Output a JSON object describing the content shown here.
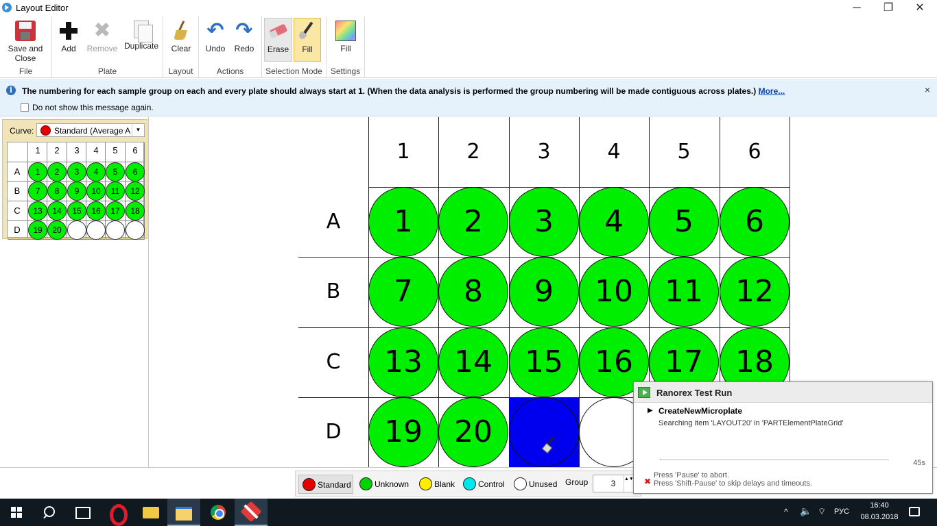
{
  "window": {
    "title": "Layout Editor",
    "minimize": "─",
    "restore": "❐",
    "close": "✕"
  },
  "ribbon": {
    "groups": {
      "file": "File",
      "plate": "Plate",
      "layout": "Layout",
      "actions": "Actions",
      "selection_mode": "Selection Mode",
      "settings": "Settings"
    },
    "buttons": {
      "save_close_line1": "Save and",
      "save_close_line2": "Close",
      "add": "Add",
      "remove": "Remove",
      "duplicate": "Duplicate",
      "clear": "Clear",
      "undo": "Undo",
      "redo": "Redo",
      "erase": "Erase",
      "fill_mode": "Fill",
      "fill_settings": "Fill"
    },
    "icons": {
      "remove": "✖",
      "undo": "↶",
      "redo": "↷"
    }
  },
  "infobar": {
    "icon": "i",
    "message": "The numbering for each sample group on each and every plate should always start at 1. (When the data analysis is performed the group numbering will be made contiguous across plates.) ",
    "more_link": "More...",
    "close": "×",
    "dont_show": "Do not show this message again."
  },
  "curve": {
    "label": "Curve:",
    "selected": "Standard (Average A",
    "arrow": "▼",
    "dot_color": "#e50000"
  },
  "plate": {
    "columns": [
      "1",
      "2",
      "3",
      "4",
      "5",
      "6"
    ],
    "rows": [
      "A",
      "B",
      "C",
      "D"
    ],
    "wells": [
      [
        "1",
        "2",
        "3",
        "4",
        "5",
        "6"
      ],
      [
        "7",
        "8",
        "9",
        "10",
        "11",
        "12"
      ],
      [
        "13",
        "14",
        "15",
        "16",
        "17",
        "18"
      ],
      [
        "19",
        "20",
        "",
        "",
        "",
        ""
      ]
    ],
    "selected_well": "D3",
    "colors": {
      "unknown": "#00ee00",
      "selected": "#0000ee",
      "unused": "#ffffff"
    }
  },
  "legend": {
    "items": [
      {
        "label": "Standard",
        "color": "#e50000"
      },
      {
        "label": "Unknown",
        "color": "#00d400"
      },
      {
        "label": "Blank",
        "color": "#ffee00"
      },
      {
        "label": "Control",
        "color": "#00e5ee"
      },
      {
        "label": "Unused",
        "color": "#ffffff"
      }
    ],
    "group_label": "Group",
    "group_value": "3",
    "spin": "▲▼"
  },
  "ranorex": {
    "title": "Ranorex Test Run",
    "arrow": "▶",
    "test_name": "CreateNewMicroplate",
    "status": "Searching item 'LAYOUT20' in 'PARTElementPlateGrid'",
    "time": "45s",
    "abort_icon": "✖",
    "hint1": "Press 'Pause' to abort.",
    "hint2": "Press 'Shift-Pause' to skip delays and timeouts."
  },
  "taskbar": {
    "tray_arrow": "^",
    "volume": "🔈",
    "network": "⌔",
    "language": "РУС",
    "time": "16:40",
    "date": "08.03.2018"
  }
}
